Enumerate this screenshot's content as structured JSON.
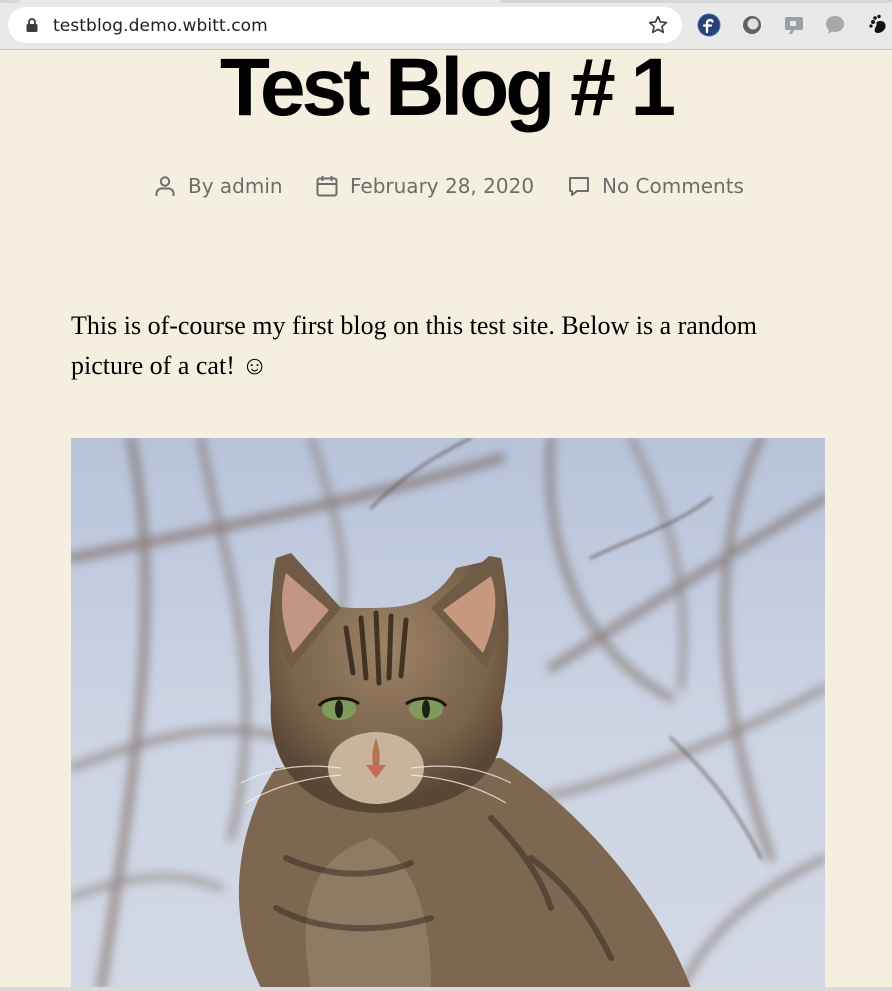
{
  "browser": {
    "url": "testblog.demo.wbitt.com",
    "extensions": [
      "fedora-icon",
      "circle-extension-icon",
      "screen-extension-icon",
      "chat-bubble-icon",
      "gnome-foot-icon"
    ]
  },
  "post": {
    "title": "Test Blog # 1",
    "meta": {
      "author_prefix": "By ",
      "author": "admin",
      "date": "February 28, 2020",
      "comments": "No Comments"
    },
    "body": "This is of-course my first blog on this test site. Below is a random picture of a cat! ☺",
    "image": {
      "subject": "tabby cat",
      "background_color": "#c9d2e4"
    }
  },
  "colors": {
    "page_background": "#f5efe0",
    "meta_text": "#6d6d6d",
    "title_text": "#000000"
  }
}
